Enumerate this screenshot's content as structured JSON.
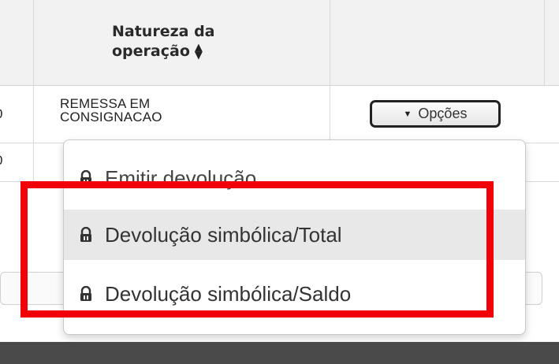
{
  "table": {
    "header": {
      "column_title": "Natureza da operação",
      "column_title_line1": "Natureza da",
      "column_title_line2": "operação",
      "sort_icon": "sort-icon"
    },
    "rows": [
      {
        "partial_value": "0",
        "nature_line1": "REMESSA EM",
        "nature_line2": "CONSIGNACAO",
        "options_label": "Opções"
      },
      {
        "partial_value": "0"
      }
    ]
  },
  "dropdown": {
    "items": [
      {
        "label": "Emitir devolução",
        "icon": "lock-icon"
      },
      {
        "label": "Devolução simbólica/Total",
        "icon": "lock-icon",
        "highlighted": true
      },
      {
        "label": "Devolução simbólica/Saldo",
        "icon": "lock-icon"
      }
    ]
  },
  "annotation": {
    "color": "#f2000a"
  }
}
